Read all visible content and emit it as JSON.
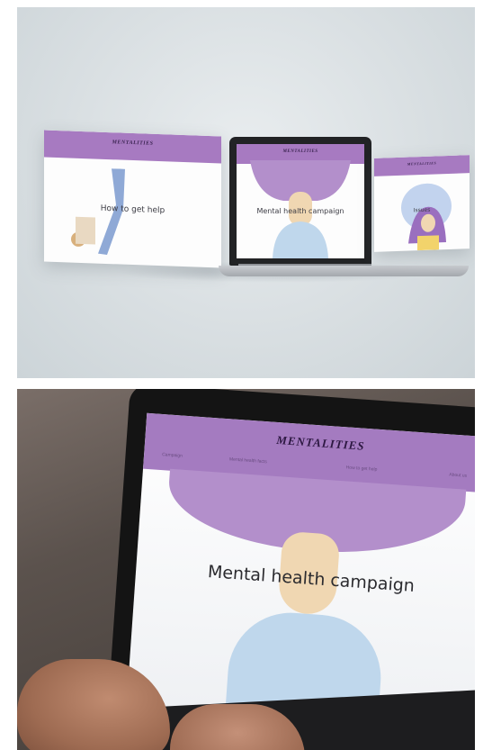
{
  "mockup_top": {
    "left_screen": {
      "brand": "MENTALITIES",
      "title": "How to get help"
    },
    "center_screen": {
      "brand": "MENTALITIES",
      "title": "Mental health campaign"
    },
    "right_screen": {
      "brand": "MENTALITIES",
      "title": "Issues"
    }
  },
  "photo_bottom": {
    "brand": "MENTALITIES",
    "nav": [
      "Campaign",
      "Mental health facts",
      "How to get help",
      "About us"
    ],
    "hero_title": "Mental health campaign"
  },
  "colors": {
    "accent_purple": "#a77ac1",
    "hair_purple": "#b38fcb",
    "background_gray": "#d9dfe2"
  }
}
